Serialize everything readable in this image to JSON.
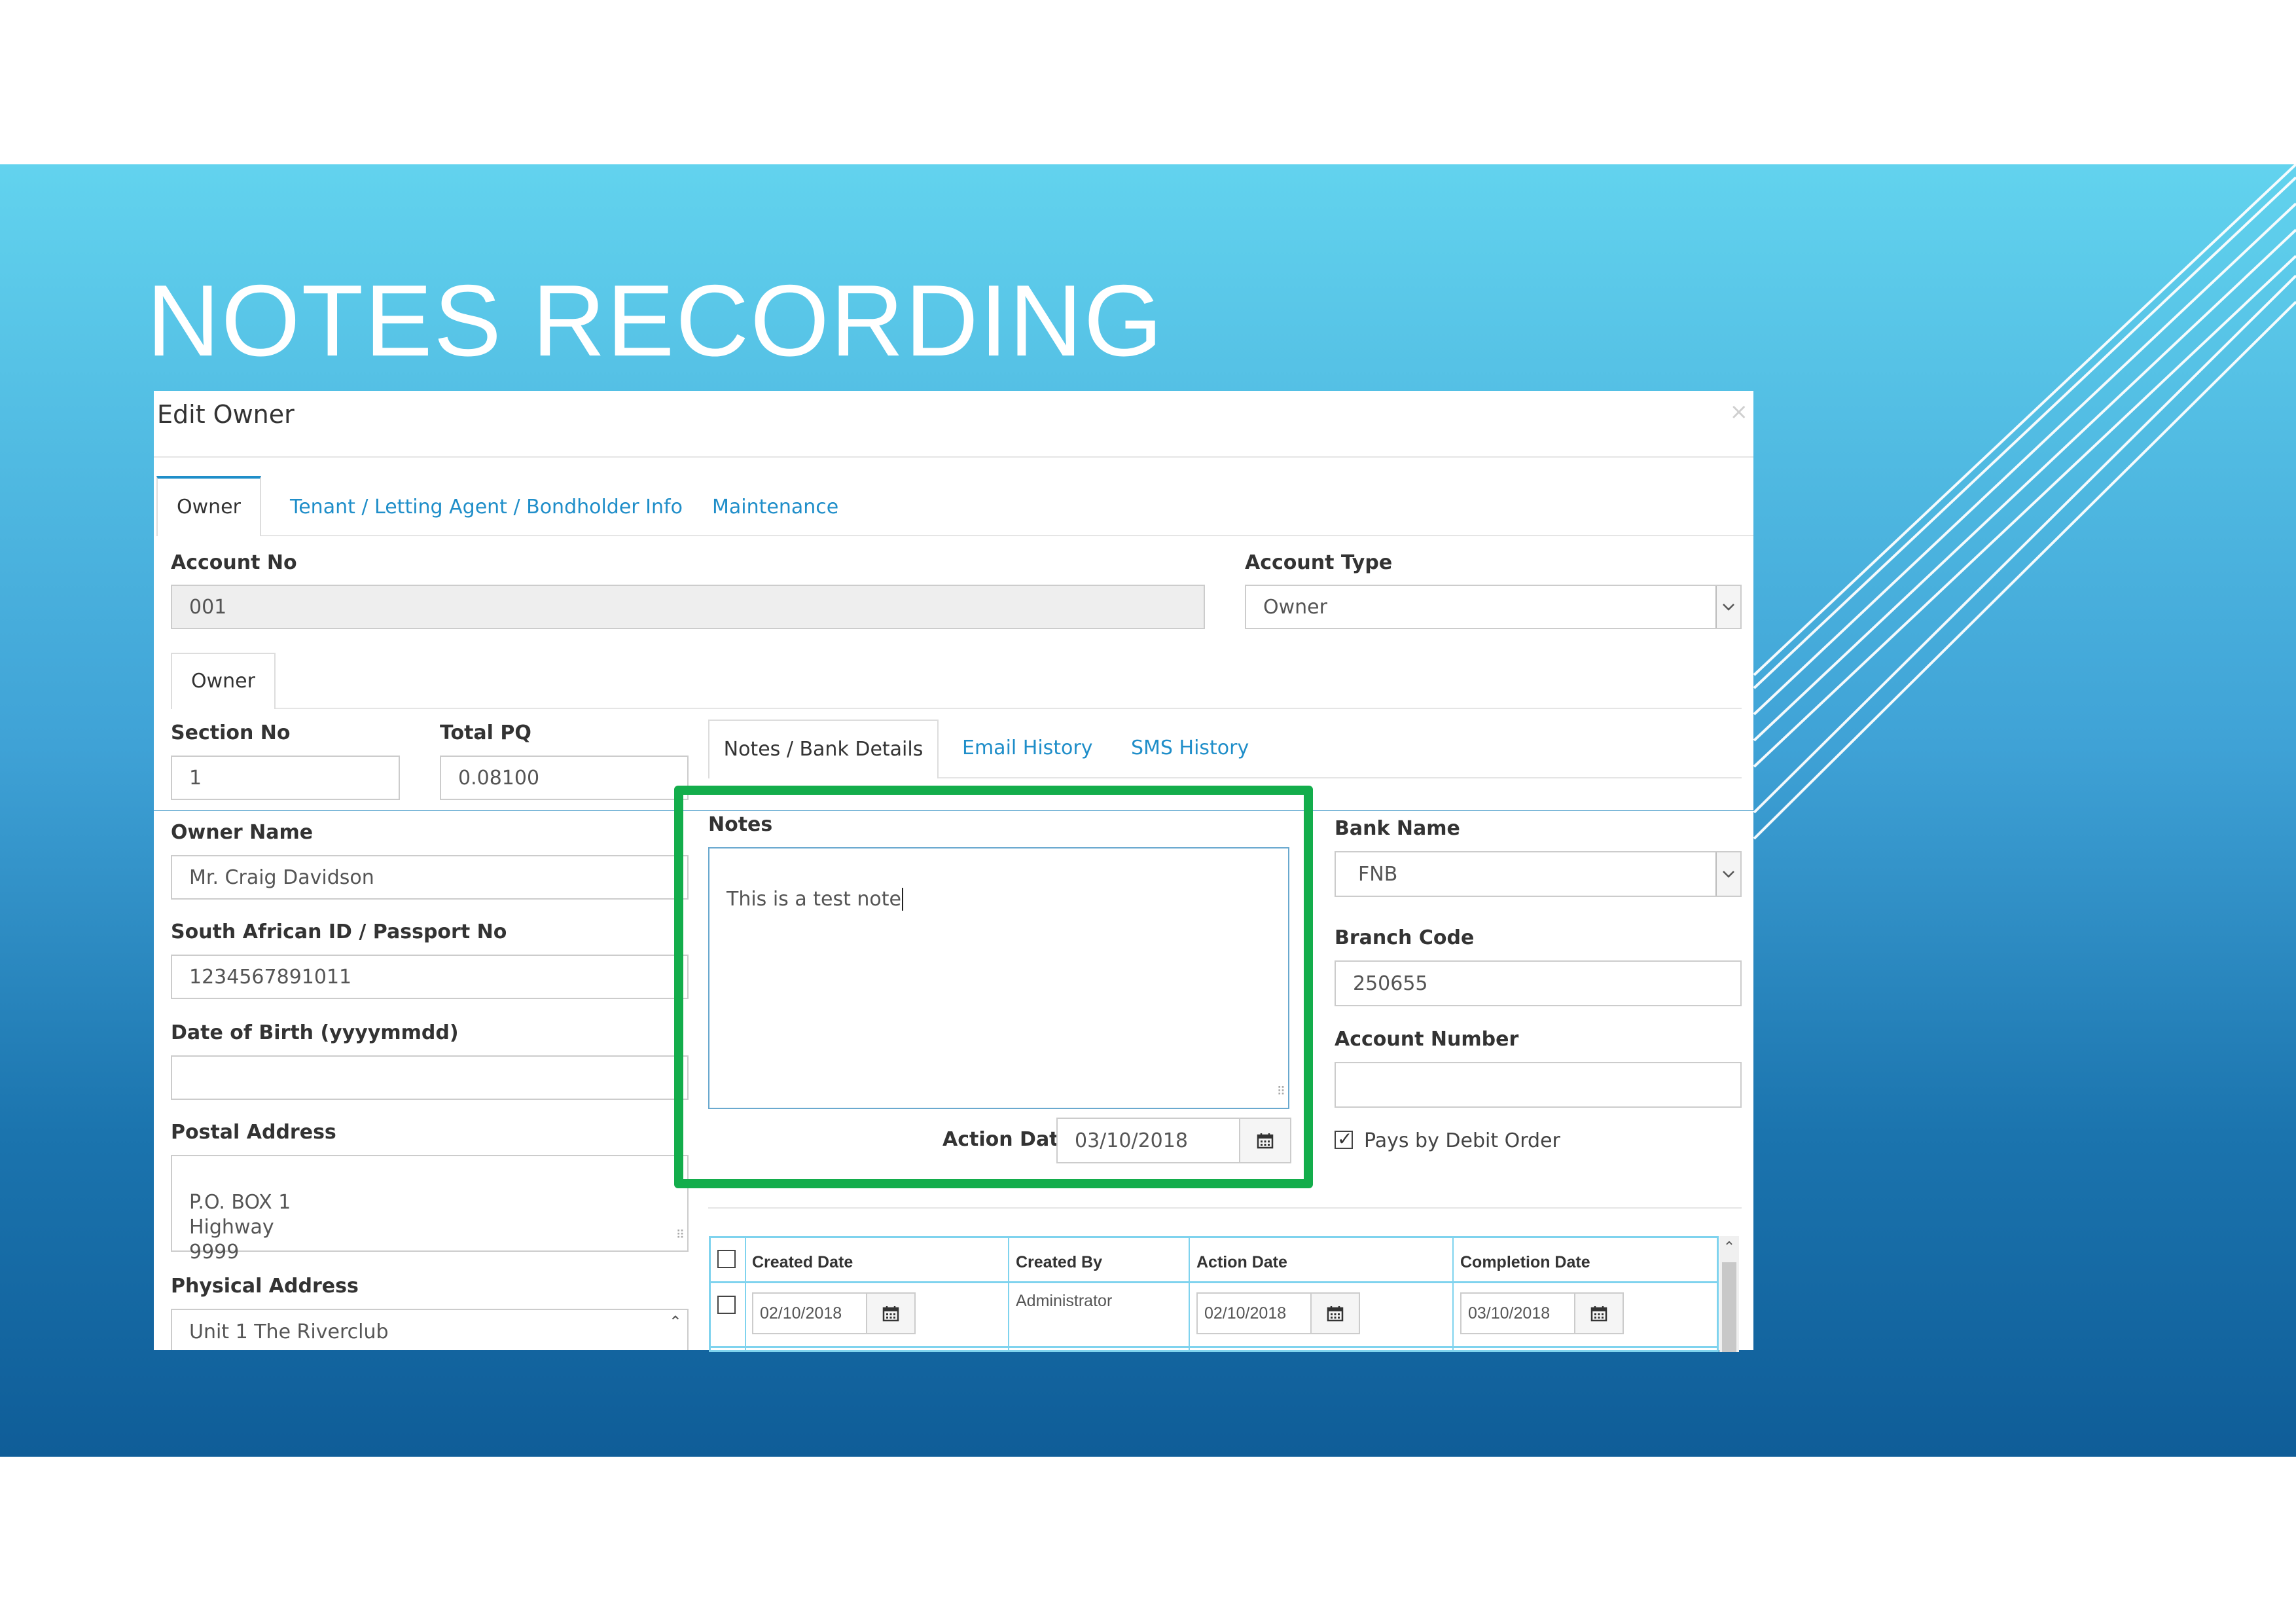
{
  "slide": {
    "title": "NOTES RECORDING"
  },
  "dialog": {
    "title": "Edit Owner",
    "close": "×",
    "tabs": [
      "Owner",
      "Tenant / Letting Agent / Bondholder Info",
      "Maintenance"
    ],
    "account_no": {
      "label": "Account No",
      "value": "001"
    },
    "account_type": {
      "label": "Account Type",
      "value": "Owner"
    },
    "sub_tab": "Owner",
    "section_no": {
      "label": "Section No",
      "value": "1"
    },
    "total_pq": {
      "label": "Total PQ",
      "value": "0.08100"
    },
    "owner_name": {
      "label": "Owner Name",
      "value": "Mr. Craig Davidson"
    },
    "id_no": {
      "label": "South African ID / Passport No",
      "value": "1234567891011"
    },
    "dob": {
      "label": "Date of Birth (yyyymmdd)",
      "value": ""
    },
    "postal": {
      "label": "Postal Address",
      "value": "P.O. BOX 1\nHighway\n9999"
    },
    "physical": {
      "label": "Physical Address",
      "value": "Unit 1 The Riverclub"
    },
    "detail_tabs": [
      "Notes / Bank Details",
      "Email History",
      "SMS History"
    ],
    "notes": {
      "label": "Notes",
      "value": "This is a test note"
    },
    "action_date": {
      "label": "Action Date",
      "value": "03/10/2018"
    },
    "bank_name": {
      "label": "Bank Name",
      "value": "FNB"
    },
    "branch_code": {
      "label": "Branch Code",
      "value": "250655"
    },
    "account_number": {
      "label": "Account Number",
      "value": ""
    },
    "debit_order": {
      "label": "Pays by Debit Order",
      "checked": true
    },
    "grid": {
      "columns": [
        "Created Date",
        "Created By",
        "Action Date",
        "Completion Date"
      ],
      "rows": [
        {
          "created_date": "02/10/2018",
          "created_by": "Administrator",
          "action_date": "02/10/2018",
          "completion_date": "03/10/2018"
        }
      ]
    }
  },
  "colors": {
    "highlight": "#13ad4b",
    "link": "#1f8ec9",
    "grid_border": "#7fd3ee"
  },
  "icons": [
    "calendar-icon",
    "chevron-down-icon",
    "close-icon",
    "checkbox-icon",
    "resize-grip-icon",
    "scroll-up-icon"
  ]
}
